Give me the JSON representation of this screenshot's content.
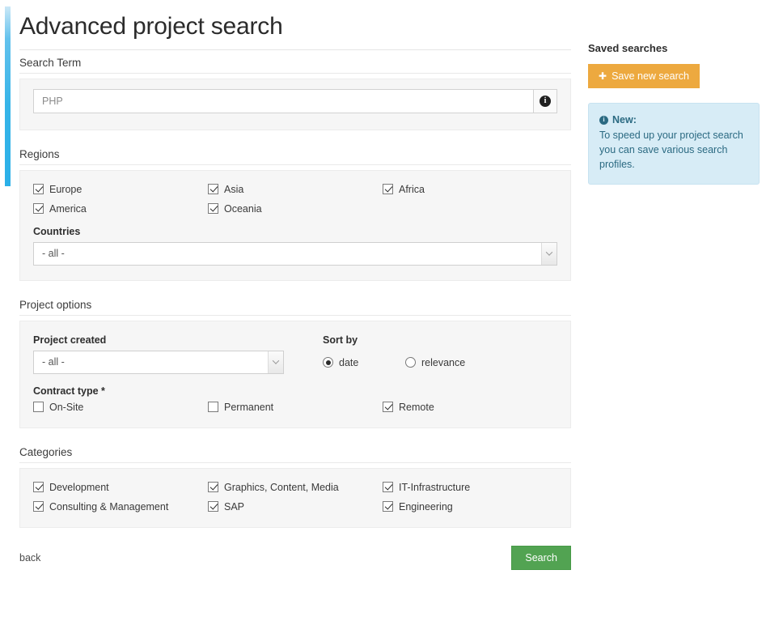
{
  "page": {
    "title": "Advanced project search"
  },
  "search_term": {
    "label": "Search Term",
    "value": "PHP",
    "placeholder": "PHP",
    "info_icon": "info-icon"
  },
  "regions": {
    "label": "Regions",
    "options": [
      {
        "label": "Europe",
        "checked": true
      },
      {
        "label": "Asia",
        "checked": true
      },
      {
        "label": "Africa",
        "checked": true
      },
      {
        "label": "America",
        "checked": true
      },
      {
        "label": "Oceania",
        "checked": true
      }
    ],
    "countries": {
      "label": "Countries",
      "value": "- all -"
    }
  },
  "project_options": {
    "label": "Project options",
    "project_created": {
      "label": "Project created",
      "value": "- all -"
    },
    "sort_by": {
      "label": "Sort by",
      "options": [
        {
          "label": "date",
          "selected": true
        },
        {
          "label": "relevance",
          "selected": false
        }
      ]
    },
    "contract_type": {
      "label": "Contract type *",
      "options": [
        {
          "label": "On-Site",
          "checked": false
        },
        {
          "label": "Permanent",
          "checked": false
        },
        {
          "label": "Remote",
          "checked": true
        }
      ]
    }
  },
  "categories": {
    "label": "Categories",
    "options": [
      {
        "label": "Development",
        "checked": true
      },
      {
        "label": "Graphics, Content, Media",
        "checked": true
      },
      {
        "label": "IT-Infrastructure",
        "checked": true
      },
      {
        "label": "Consulting & Management",
        "checked": true
      },
      {
        "label": "SAP",
        "checked": true
      },
      {
        "label": "Engineering",
        "checked": true
      }
    ]
  },
  "footer": {
    "back_label": "back",
    "search_label": "Search"
  },
  "sidebar": {
    "title": "Saved searches",
    "save_button": {
      "label": "Save new search",
      "icon": "plus-icon"
    },
    "alert": {
      "icon": "info-icon",
      "heading": "New:",
      "body": "To speed up your project search you can save various search profiles."
    }
  },
  "colors": {
    "accent_strip": "#2bb0e8",
    "save_button": "#eda93f",
    "search_button": "#52a352",
    "alert_bg": "#d7ecf6",
    "alert_text": "#2b6a82"
  }
}
